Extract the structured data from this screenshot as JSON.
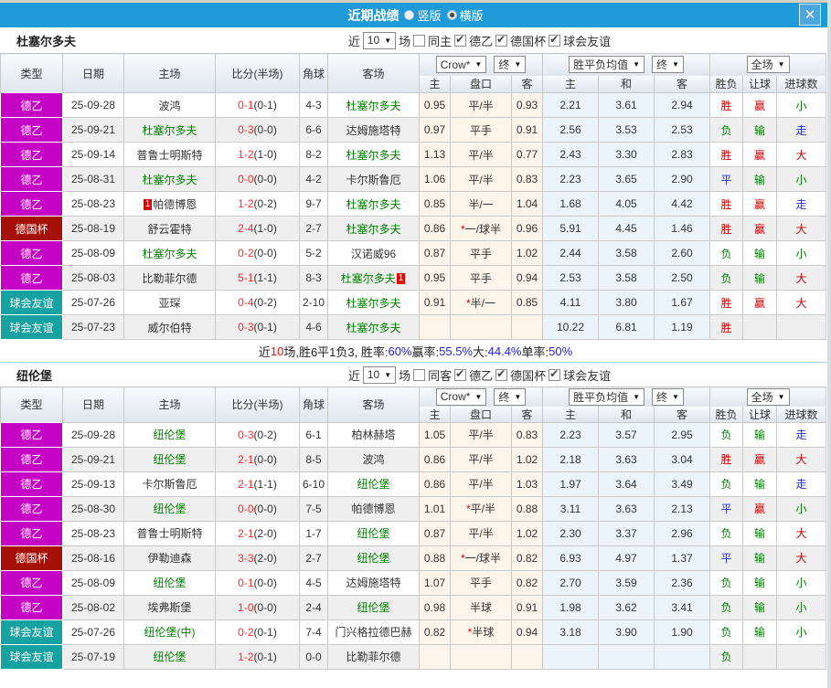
{
  "titlebar": {
    "title": "近期战绩",
    "vertical": "竖版",
    "horizontal": "横版",
    "close": "✕"
  },
  "filter": {
    "near": "近",
    "count": "10",
    "unit": "场"
  },
  "headers": {
    "type": "类型",
    "date": "日期",
    "home": "主场",
    "score": "比分(半场)",
    "corner": "角球",
    "away": "客场",
    "odds_group": {
      "select1": "Crow*",
      "select2": "终",
      "cols": [
        "主",
        "盘口",
        "客"
      ]
    },
    "mean_group": {
      "select1": "胜平负均值",
      "select2": "终",
      "cols": [
        "主",
        "和",
        "客"
      ]
    },
    "result_group": {
      "select": "全场",
      "cols": [
        "胜负",
        "让球",
        "进球数"
      ]
    }
  },
  "colors": {
    "titlebar_blue": "#1f9ad8",
    "league2_magenta": "#c503c5",
    "cup_darkred": "#a51008",
    "friendly_teal": "#17a2a2",
    "team_green": "#008000",
    "score_red": "#fb2b2b",
    "win_red": "#d40000",
    "lose_green": "#008000",
    "draw_blue": "#2633cc",
    "odds_bg": "#fdf5ea",
    "mean_bg": "#eaf4fa",
    "pct_blue": "#2222dd"
  },
  "sections": [
    {
      "team": "杜塞尔多夫",
      "same_label": "同主",
      "leagues": [
        "德乙",
        "德国杯",
        "球会友谊"
      ],
      "rows": [
        {
          "type": "德乙",
          "cls": "l2",
          "date": "25-09-28",
          "home": "波鸿",
          "hg": false,
          "score": "0-1",
          "half": "(0-1)",
          "corner": "4-3",
          "away": "杜塞尔多夫",
          "ag": true,
          "o1": "0.95",
          "st": false,
          "hc": "平/半",
          "o2": "0.93",
          "m1": "2.21",
          "m2": "3.61",
          "m3": "2.94",
          "r1": "胜",
          "r2": "赢",
          "r3": "小"
        },
        {
          "type": "德乙",
          "cls": "l2",
          "date": "25-09-21",
          "home": "杜塞尔多夫",
          "hg": true,
          "score": "0-3",
          "half": "(0-0)",
          "corner": "6-6",
          "away": "达姆施塔特",
          "ag": false,
          "o1": "0.97",
          "st": false,
          "hc": "平手",
          "o2": "0.91",
          "m1": "2.56",
          "m2": "3.53",
          "m3": "2.53",
          "r1": "负",
          "r2": "输",
          "r3": "走"
        },
        {
          "type": "德乙",
          "cls": "l2",
          "date": "25-09-14",
          "home": "普鲁士明斯特",
          "hg": false,
          "score": "1-2",
          "half": "(1-0)",
          "corner": "8-2",
          "away": "杜塞尔多夫",
          "ag": true,
          "o1": "1.13",
          "st": false,
          "hc": "平/半",
          "o2": "0.77",
          "m1": "2.43",
          "m2": "3.30",
          "m3": "2.83",
          "r1": "胜",
          "r2": "赢",
          "r3": "大"
        },
        {
          "type": "德乙",
          "cls": "l2",
          "date": "25-08-31",
          "home": "杜塞尔多夫",
          "hg": true,
          "score": "0-0",
          "half": "(0-0)",
          "corner": "4-2",
          "away": "卡尔斯鲁厄",
          "ag": false,
          "o1": "1.06",
          "st": false,
          "hc": "平/半",
          "o2": "0.83",
          "m1": "2.23",
          "m2": "3.65",
          "m3": "2.90",
          "r1": "平",
          "r2": "输",
          "r3": "小"
        },
        {
          "type": "德乙",
          "cls": "l2",
          "date": "25-08-23",
          "home": "帕德博恩",
          "hg": false,
          "hbadge": "1",
          "hbpos": "before",
          "score": "1-2",
          "half": "(0-2)",
          "corner": "9-7",
          "away": "杜塞尔多夫",
          "ag": true,
          "o1": "0.85",
          "st": false,
          "hc": "半/一",
          "o2": "1.04",
          "m1": "1.68",
          "m2": "4.05",
          "m3": "4.42",
          "r1": "胜",
          "r2": "赢",
          "r3": "走"
        },
        {
          "type": "德国杯",
          "cls": "cup",
          "date": "25-08-19",
          "home": "舒云霍特",
          "hg": false,
          "score": "2-4",
          "half": "(1-0)",
          "corner": "2-7",
          "away": "杜塞尔多夫",
          "ag": true,
          "o1": "0.86",
          "st": true,
          "hc": "一/球半",
          "o2": "0.96",
          "m1": "5.91",
          "m2": "4.45",
          "m3": "1.46",
          "r1": "胜",
          "r2": "赢",
          "r3": "大"
        },
        {
          "type": "德乙",
          "cls": "l2",
          "date": "25-08-09",
          "home": "杜塞尔多夫",
          "hg": true,
          "score": "0-2",
          "half": "(0-0)",
          "corner": "5-2",
          "away": "汉诺威96",
          "ag": false,
          "o1": "0.87",
          "st": false,
          "hc": "平手",
          "o2": "1.02",
          "m1": "2.44",
          "m2": "3.58",
          "m3": "2.60",
          "r1": "负",
          "r2": "输",
          "r3": "小"
        },
        {
          "type": "德乙",
          "cls": "l2",
          "date": "25-08-03",
          "home": "比勒菲尔德",
          "hg": false,
          "score": "5-1",
          "half": "(1-1)",
          "corner": "8-3",
          "away": "杜塞尔多夫",
          "ag": true,
          "abadge": "1",
          "abpos": "after",
          "o1": "0.95",
          "st": false,
          "hc": "平手",
          "o2": "0.94",
          "m1": "2.53",
          "m2": "3.58",
          "m3": "2.50",
          "r1": "负",
          "r2": "输",
          "r3": "大"
        },
        {
          "type": "球会友谊",
          "cls": "fr",
          "date": "25-07-26",
          "home": "亚琛",
          "hg": false,
          "score": "0-4",
          "half": "(0-2)",
          "corner": "2-10",
          "away": "杜塞尔多夫",
          "ag": true,
          "o1": "0.91",
          "st": true,
          "hc": "半/一",
          "o2": "0.85",
          "m1": "4.11",
          "m2": "3.80",
          "m3": "1.67",
          "r1": "胜",
          "r2": "赢",
          "r3": "大"
        },
        {
          "type": "球会友谊",
          "cls": "fr",
          "date": "25-07-23",
          "home": "威尔伯特",
          "hg": false,
          "score": "0-3",
          "half": "(0-1)",
          "corner": "4-6",
          "away": "杜塞尔多夫",
          "ag": true,
          "o1": "",
          "st": false,
          "hc": "",
          "o2": "",
          "m1": "10.22",
          "m2": "6.81",
          "m3": "1.19",
          "r1": "胜",
          "r2": "",
          "r3": ""
        }
      ],
      "summary": [
        {
          "text": "近",
          "c": "d"
        },
        {
          "text": "10",
          "c": "r"
        },
        {
          "text": "场,胜6平1负3, 胜率:",
          "c": "d"
        },
        {
          "text": "60%",
          "c": "b"
        },
        {
          "text": " 赢率:",
          "c": "d"
        },
        {
          "text": "55.5%",
          "c": "b"
        },
        {
          "text": " 大:",
          "c": "d"
        },
        {
          "text": "44.4%",
          "c": "b"
        },
        {
          "text": " 单率:",
          "c": "d"
        },
        {
          "text": "50%",
          "c": "b"
        }
      ]
    },
    {
      "team": "纽伦堡",
      "same_label": "同客",
      "leagues": [
        "德乙",
        "德国杯",
        "球会友谊"
      ],
      "rows": [
        {
          "type": "德乙",
          "cls": "l2",
          "date": "25-09-28",
          "home": "纽伦堡",
          "hg": true,
          "score": "0-3",
          "half": "(0-2)",
          "corner": "6-1",
          "away": "柏林赫塔",
          "ag": false,
          "o1": "1.05",
          "st": false,
          "hc": "平/半",
          "o2": "0.83",
          "m1": "2.23",
          "m2": "3.57",
          "m3": "2.95",
          "r1": "负",
          "r2": "输",
          "r3": "走"
        },
        {
          "type": "德乙",
          "cls": "l2",
          "date": "25-09-21",
          "home": "纽伦堡",
          "hg": true,
          "score": "2-1",
          "half": "(0-0)",
          "corner": "8-5",
          "away": "波鸿",
          "ag": false,
          "o1": "0.86",
          "st": false,
          "hc": "平/半",
          "o2": "1.02",
          "m1": "2.18",
          "m2": "3.63",
          "m3": "3.04",
          "r1": "胜",
          "r2": "赢",
          "r3": "大"
        },
        {
          "type": "德乙",
          "cls": "l2",
          "date": "25-09-13",
          "home": "卡尔斯鲁厄",
          "hg": false,
          "score": "2-1",
          "half": "(1-1)",
          "corner": "6-10",
          "away": "纽伦堡",
          "ag": true,
          "o1": "0.86",
          "st": false,
          "hc": "平/半",
          "o2": "1.03",
          "m1": "1.97",
          "m2": "3.64",
          "m3": "3.49",
          "r1": "负",
          "r2": "输",
          "r3": "走"
        },
        {
          "type": "德乙",
          "cls": "l2",
          "date": "25-08-30",
          "home": "纽伦堡",
          "hg": true,
          "score": "0-0",
          "half": "(0-0)",
          "corner": "7-5",
          "away": "帕德博恩",
          "ag": false,
          "o1": "1.01",
          "st": true,
          "hc": "平/半",
          "o2": "0.88",
          "m1": "3.11",
          "m2": "3.63",
          "m3": "2.13",
          "r1": "平",
          "r2": "赢",
          "r3": "小"
        },
        {
          "type": "德乙",
          "cls": "l2",
          "date": "25-08-23",
          "home": "普鲁士明斯特",
          "hg": false,
          "score": "2-1",
          "half": "(2-0)",
          "corner": "1-7",
          "away": "纽伦堡",
          "ag": true,
          "o1": "0.87",
          "st": false,
          "hc": "平/半",
          "o2": "1.02",
          "m1": "2.30",
          "m2": "3.37",
          "m3": "2.96",
          "r1": "负",
          "r2": "输",
          "r3": "大"
        },
        {
          "type": "德国杯",
          "cls": "cup",
          "date": "25-08-16",
          "home": "伊勒迪森",
          "hg": false,
          "score": "3-3",
          "half": "(2-0)",
          "corner": "2-7",
          "away": "纽伦堡",
          "ag": true,
          "o1": "0.88",
          "st": true,
          "hc": "一/球半",
          "o2": "0.82",
          "m1": "6.93",
          "m2": "4.97",
          "m3": "1.37",
          "r1": "平",
          "r2": "输",
          "r3": "大"
        },
        {
          "type": "德乙",
          "cls": "l2",
          "date": "25-08-09",
          "home": "纽伦堡",
          "hg": true,
          "score": "0-1",
          "half": "(0-0)",
          "corner": "4-5",
          "away": "达姆施塔特",
          "ag": false,
          "o1": "1.07",
          "st": false,
          "hc": "平手",
          "o2": "0.82",
          "m1": "2.70",
          "m2": "3.59",
          "m3": "2.36",
          "r1": "负",
          "r2": "输",
          "r3": "小"
        },
        {
          "type": "德乙",
          "cls": "l2",
          "date": "25-08-02",
          "home": "埃弗斯堡",
          "hg": false,
          "score": "1-0",
          "half": "(0-0)",
          "corner": "2-4",
          "away": "纽伦堡",
          "ag": true,
          "o1": "0.98",
          "st": false,
          "hc": "半球",
          "o2": "0.91",
          "m1": "1.98",
          "m2": "3.62",
          "m3": "3.41",
          "r1": "负",
          "r2": "输",
          "r3": "小"
        },
        {
          "type": "球会友谊",
          "cls": "fr",
          "date": "25-07-26",
          "home": "纽伦堡(中)",
          "hg": true,
          "score": "0-2",
          "half": "(0-1)",
          "corner": "7-4",
          "away": "门兴格拉德巴赫",
          "ag": false,
          "o1": "0.82",
          "st": true,
          "hc": "半球",
          "o2": "0.94",
          "m1": "3.18",
          "m2": "3.90",
          "m3": "1.90",
          "r1": "负",
          "r2": "输",
          "r3": "小"
        },
        {
          "type": "球会友谊",
          "cls": "fr",
          "date": "25-07-19",
          "home": "纽伦堡",
          "hg": true,
          "score": "1-2",
          "half": "(0-1)",
          "corner": "0-0",
          "away": "比勒菲尔德",
          "ag": false,
          "o1": "",
          "st": false,
          "hc": "",
          "o2": "",
          "m1": "",
          "m2": "",
          "m3": "",
          "r1": "负",
          "r2": "",
          "r3": ""
        }
      ],
      "summary": null
    }
  ]
}
